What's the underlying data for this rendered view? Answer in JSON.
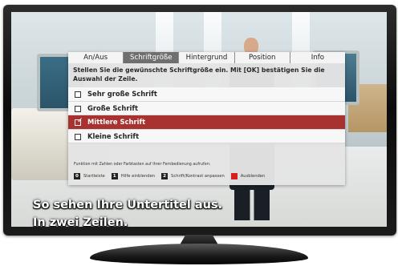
{
  "osd": {
    "tabs": [
      {
        "label": "An/Aus"
      },
      {
        "label": "Schriftgröße",
        "active": true
      },
      {
        "label": "Hintergrund"
      },
      {
        "label": "Position"
      },
      {
        "label": "Info"
      }
    ],
    "instruction": "Stellen Sie die gewünschte Schriftgröße ein. Mit [OK] bestätigen Sie die Auswahl der Zeile.",
    "options": [
      {
        "label": "Sehr große Schrift",
        "checked": false
      },
      {
        "label": "Große Schrift",
        "checked": false
      },
      {
        "label": "Mittlere Schrift",
        "checked": true
      },
      {
        "label": "Kleine Schrift",
        "checked": false
      }
    ],
    "checkmark_glyph": "✓",
    "footer_hint": "Funktion mit Zahlen oder Farbtasten auf Ihrer Fernbedienung aufrufen:",
    "keys": [
      {
        "key": "0",
        "label": "Startleiste"
      },
      {
        "key": "1",
        "label": "Hilfe einblenden"
      },
      {
        "key": "2",
        "label": "Schrift/Kontrast anpassen"
      },
      {
        "key": "red",
        "label": "Ausblenden"
      }
    ]
  },
  "subtitles": {
    "line1": "So sehen Ihre Untertitel aus.",
    "line2": "In zwei Zeilen."
  },
  "colors": {
    "selected_row": "#a8322f",
    "active_tab": "#6f6f6f",
    "red_key": "#d42020"
  }
}
